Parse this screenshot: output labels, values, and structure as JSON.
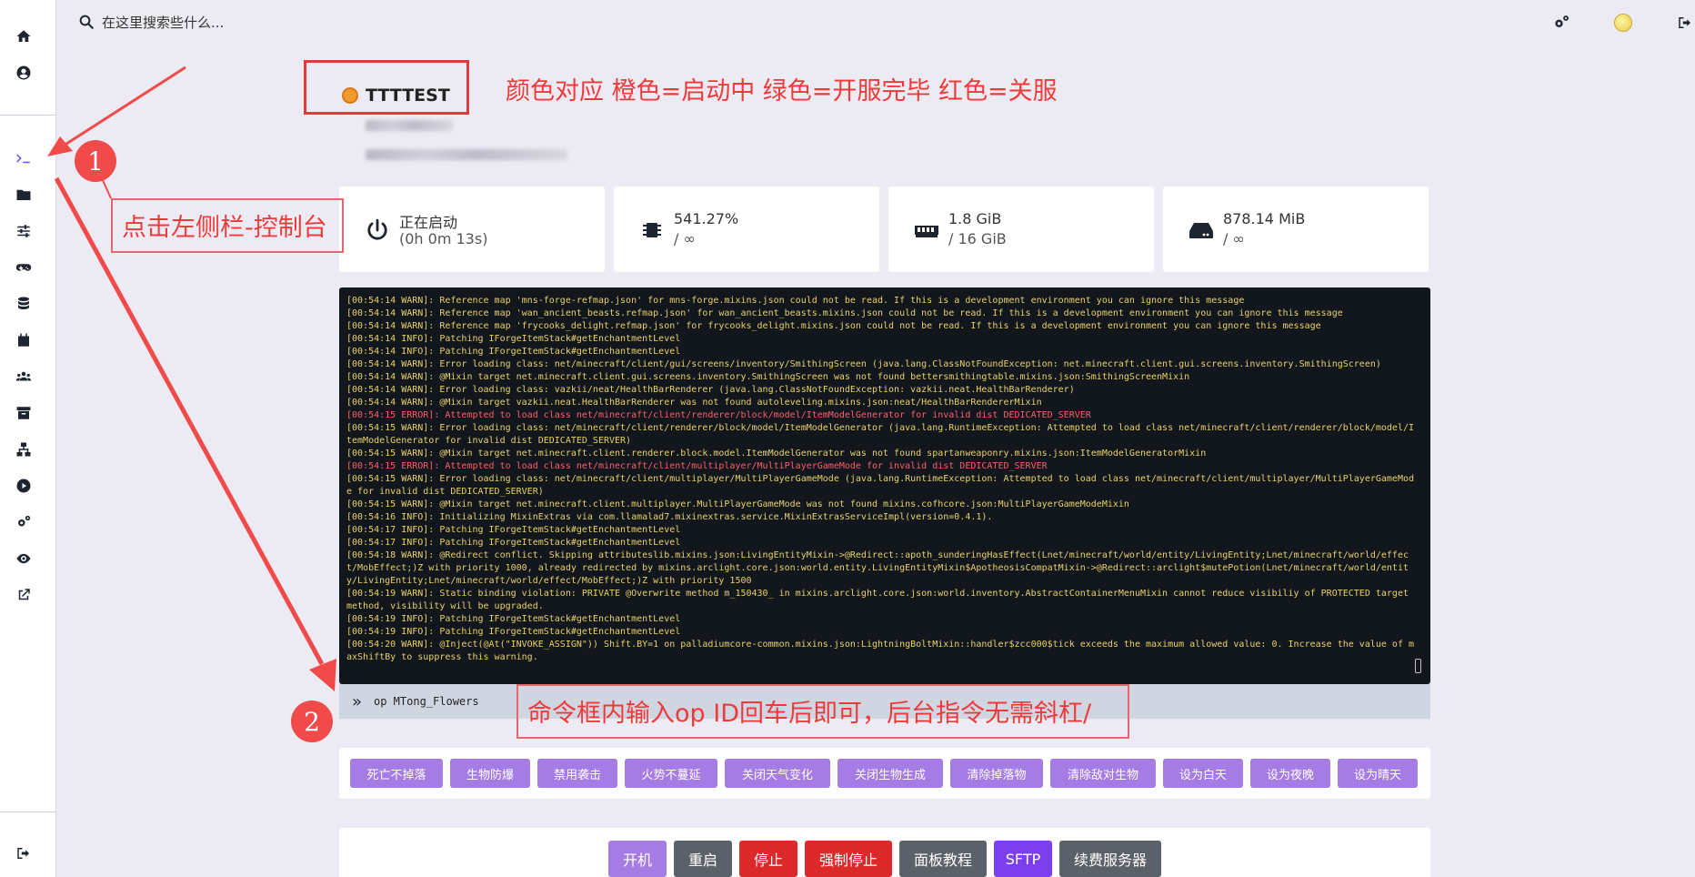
{
  "search": {
    "placeholder": "在这里搜索些什么..."
  },
  "server": {
    "name": "TTTTEST"
  },
  "annotations": {
    "color_legend": "颜色对应 橙色=启动中 绿色=开服完毕 红色=关服",
    "step1_num": "1",
    "step1_text": "点击左侧栏-控制台",
    "step2_num": "2",
    "step2_text": "命令框内输入op ID回车后即可，后台指令无需斜杠/"
  },
  "stats": {
    "status": {
      "line1": "正在启动",
      "line2": "(0h 0m 13s)"
    },
    "cpu": {
      "line1": "541.27%",
      "line2": "/ ∞"
    },
    "memory": {
      "line1": "1.8 GiB",
      "line2": "/ 16 GiB"
    },
    "disk": {
      "line1": "878.14 MiB",
      "line2": "/ ∞"
    }
  },
  "console": {
    "lines": [
      {
        "text": "[00:54:14 WARN]: Reference map 'mns-forge-refmap.json' for mns-forge.mixins.json could not be read. If this is a development environment you can ignore this message",
        "level": "warn"
      },
      {
        "text": "[00:54:14 WARN]: Reference map 'wan_ancient_beasts.refmap.json' for wan_ancient_beasts.mixins.json could not be read. If this is a development environment you can ignore this message",
        "level": "warn"
      },
      {
        "text": "[00:54:14 WARN]: Reference map 'frycooks_delight.refmap.json' for frycooks_delight.mixins.json could not be read. If this is a development environment you can ignore this message",
        "level": "warn"
      },
      {
        "text": "[00:54:14 INFO]: Patching IForgeItemStack#getEnchantmentLevel",
        "level": "info"
      },
      {
        "text": "[00:54:14 INFO]: Patching IForgeItemStack#getEnchantmentLevel",
        "level": "info"
      },
      {
        "text": "[00:54:14 WARN]: Error loading class: net/minecraft/client/gui/screens/inventory/SmithingScreen (java.lang.ClassNotFoundException: net.minecraft.client.gui.screens.inventory.SmithingScreen)",
        "level": "warn"
      },
      {
        "text": "[00:54:14 WARN]: @Mixin target net.minecraft.client.gui.screens.inventory.SmithingScreen was not found bettersmithingtable.mixins.json:SmithingScreenMixin",
        "level": "warn"
      },
      {
        "text": "[00:54:14 WARN]: Error loading class: vazkii/neat/HealthBarRenderer (java.lang.ClassNotFoundException: vazkii.neat.HealthBarRenderer)",
        "level": "warn"
      },
      {
        "text": "[00:54:14 WARN]: @Mixin target vazkii.neat.HealthBarRenderer was not found autoleveling.mixins.json:neat/HealthBarRendererMixin",
        "level": "warn"
      },
      {
        "text": "[00:54:15 ERROR]: Attempted to load class net/minecraft/client/renderer/block/model/ItemModelGenerator for invalid dist DEDICATED_SERVER",
        "level": "error"
      },
      {
        "text": "[00:54:15 WARN]: Error loading class: net/minecraft/client/renderer/block/model/ItemModelGenerator (java.lang.RuntimeException: Attempted to load class net/minecraft/client/renderer/block/model/ItemModelGenerator for invalid dist DEDICATED_SERVER)",
        "level": "warn"
      },
      {
        "text": "[00:54:15 WARN]: @Mixin target net.minecraft.client.renderer.block.model.ItemModelGenerator was not found spartanweaponry.mixins.json:ItemModelGeneratorMixin",
        "level": "warn"
      },
      {
        "text": "[00:54:15 ERROR]: Attempted to load class net/minecraft/client/multiplayer/MultiPlayerGameMode for invalid dist DEDICATED_SERVER",
        "level": "error"
      },
      {
        "text": "[00:54:15 WARN]: Error loading class: net/minecraft/client/multiplayer/MultiPlayerGameMode (java.lang.RuntimeException: Attempted to load class net/minecraft/client/multiplayer/MultiPlayerGameMode for invalid dist DEDICATED_SERVER)",
        "level": "warn"
      },
      {
        "text": "[00:54:15 WARN]: @Mixin target net.minecraft.client.multiplayer.MultiPlayerGameMode was not found mixins.cofhcore.json:MultiPlayerGameModeMixin",
        "level": "warn"
      },
      {
        "text": "[00:54:16 INFO]: Initializing MixinExtras via com.llamalad7.mixinextras.service.MixinExtrasServiceImpl(version=0.4.1).",
        "level": "info"
      },
      {
        "text": "[00:54:17 INFO]: Patching IForgeItemStack#getEnchantmentLevel",
        "level": "info"
      },
      {
        "text": "[00:54:17 INFO]: Patching IForgeItemStack#getEnchantmentLevel",
        "level": "info"
      },
      {
        "text": "[00:54:18 WARN]: @Redirect conflict. Skipping attributeslib.mixins.json:LivingEntityMixin->@Redirect::apoth_sunderingHasEffect(Lnet/minecraft/world/entity/LivingEntity;Lnet/minecraft/world/effect/MobEffect;)Z with priority 1000, already redirected by mixins.arclight.core.json:world.entity.LivingEntityMixin$ApotheosisCompatMixin->@Redirect::arclight$mutePotion(Lnet/minecraft/world/entity/LivingEntity;Lnet/minecraft/world/effect/MobEffect;)Z with priority 1500",
        "level": "warn"
      },
      {
        "text": "[00:54:19 WARN]: Static binding violation: PRIVATE @Overwrite method m_150430_ in mixins.arclight.core.json:world.inventory.AbstractContainerMenuMixin cannot reduce visibiliy of PROTECTED target method, visibility will be upgraded.",
        "level": "warn"
      },
      {
        "text": "[00:54:19 INFO]: Patching IForgeItemStack#getEnchantmentLevel",
        "level": "info"
      },
      {
        "text": "[00:54:19 INFO]: Patching IForgeItemStack#getEnchantmentLevel",
        "level": "info"
      },
      {
        "text": "[00:54:20 WARN]: @Inject(@At(\"INVOKE_ASSIGN\")) Shift.BY=1 on palladiumcore-common.mixins.json:LightningBoltMixin::handler$zcc000$tick exceeds the maximum allowed value: 0. Increase the value of maxShiftBy to suppress this warning.",
        "level": "warn"
      }
    ]
  },
  "command": {
    "value": "op MTong_Flowers",
    "chevron": "»"
  },
  "quick_buttons": [
    "死亡不掉落",
    "生物防爆",
    "禁用袭击",
    "火势不蔓延",
    "关闭天气变化",
    "关闭生物生成",
    "清除掉落物",
    "清除敌对生物",
    "设为白天",
    "设为夜晚",
    "设为晴天"
  ],
  "control_buttons": [
    {
      "label": "开机",
      "color": "#a57ce4"
    },
    {
      "label": "重启",
      "color": "#5a6168"
    },
    {
      "label": "停止",
      "color": "#dc2a2a"
    },
    {
      "label": "强制停止",
      "color": "#dc2a2a"
    },
    {
      "label": "面板教程",
      "color": "#5a6168"
    },
    {
      "label": "SFTP",
      "color": "#7b3ff0"
    },
    {
      "label": "续费服务器",
      "color": "#5a6168"
    }
  ],
  "colors": {
    "accent": "#a57ce4",
    "annotation_red": "#f03a3a",
    "status_orange": "#f39a2a"
  }
}
